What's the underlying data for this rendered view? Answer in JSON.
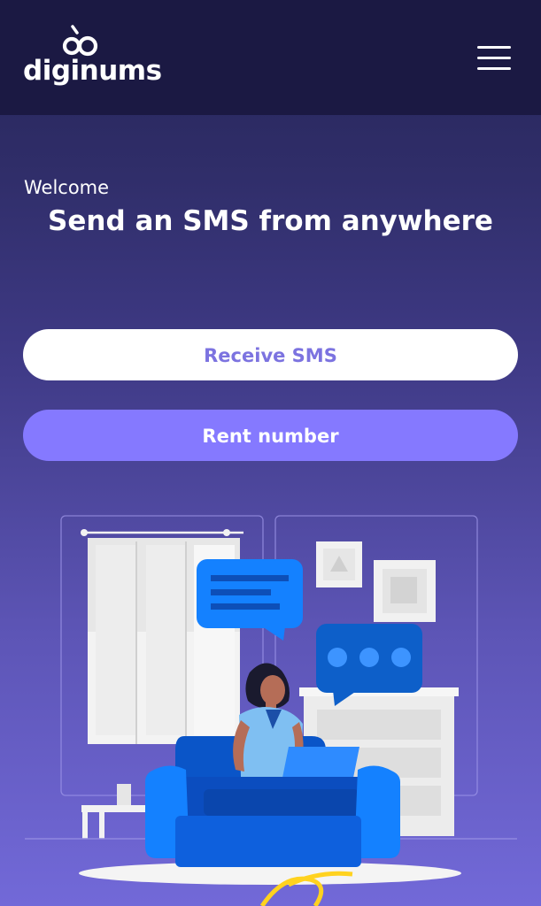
{
  "brand": {
    "logo_text": "diginums",
    "logo_icon": "diginums-logo-icon"
  },
  "header": {
    "menu_icon": "hamburger-menu-icon"
  },
  "hero": {
    "welcome": "Welcome",
    "headline": "Send an SMS from anywhere"
  },
  "actions": {
    "receive_label": "Receive SMS",
    "rent_label": "Rent number"
  },
  "illustration": {
    "name": "woman-on-sofa-with-laptop-illustration",
    "icons": [
      "chat-bubble-lines-icon",
      "chat-bubble-dots-icon"
    ]
  },
  "colors": {
    "header_bg": "#1b1943",
    "accent_purple": "#8579ff",
    "accent_text": "#7c73e0",
    "illustration_blue": "#1481ff"
  }
}
